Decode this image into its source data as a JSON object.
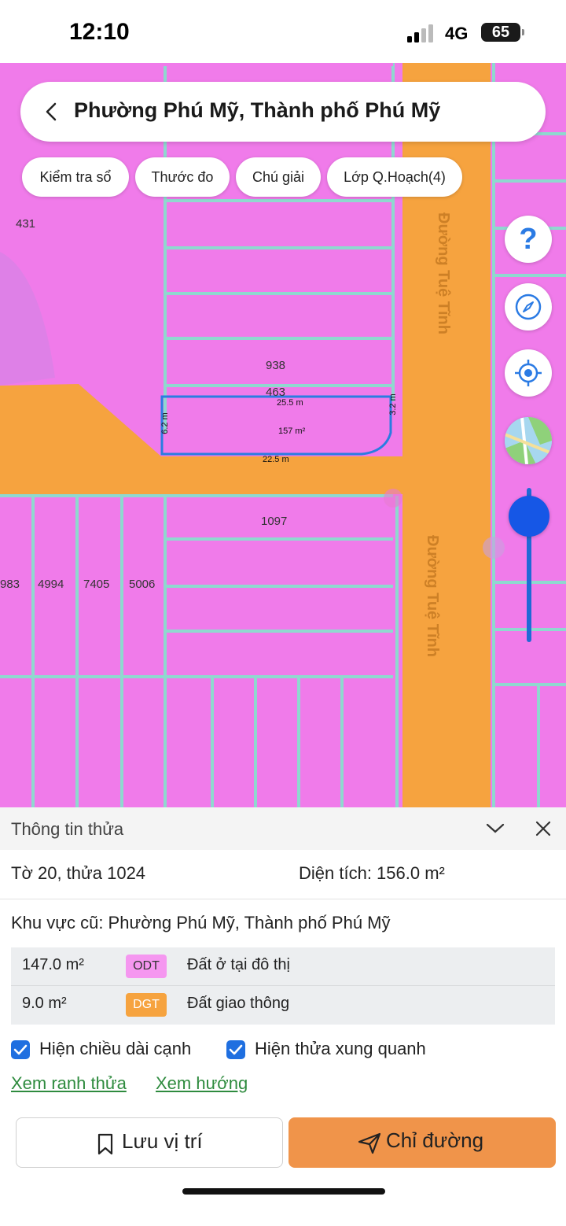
{
  "status_bar": {
    "time": "12:10",
    "network": "4G",
    "battery": "65"
  },
  "header": {
    "title": "Phường Phú Mỹ, Thành phố Phú Mỹ"
  },
  "chips": [
    "Kiểm tra sổ",
    "Thước đo",
    "Chú giải",
    "Lớp Q.Hoạch(4)"
  ],
  "controls": {
    "help": "?"
  },
  "map": {
    "labels": [
      "431",
      "938",
      "463",
      "1097",
      "983",
      "4994",
      "7405",
      "5006"
    ],
    "dimensions": {
      "top": "25.5 m",
      "bottom": "22.5 m",
      "left": "6.2 m",
      "right": "3.2 m",
      "area": "157 m²"
    },
    "streets": [
      "Đường Tuệ Tĩnh",
      "Đường Tuệ Tĩnh"
    ]
  },
  "sheet": {
    "title": "Thông tin thửa",
    "parcel": "Tờ 20, thửa 1024",
    "area": "Diện tích: 156.0 m²",
    "old_area": "Khu vực cũ: Phường Phú Mỹ, Thành phố Phú Mỹ",
    "uses": [
      {
        "area": "147.0 m²",
        "code": "ODT",
        "desc": "Đất ở tại đô thị",
        "color": "#f597f0"
      },
      {
        "area": "9.0 m²",
        "code": "DGT",
        "desc": "Đất giao thông",
        "color": "#f6a33f"
      }
    ],
    "checkboxes": [
      "Hiện chiều dài cạnh",
      "Hiện thửa xung quanh"
    ],
    "links": [
      "Xem ranh thửa",
      "Xem hướng"
    ],
    "buttons": {
      "save": "Lưu vị trí",
      "directions": "Chỉ đường"
    }
  },
  "colors": {
    "residential": "#f07bea",
    "road": "#f6a33f",
    "parcel_line": "#8fd8cf",
    "accent": "#1f6fe0"
  }
}
